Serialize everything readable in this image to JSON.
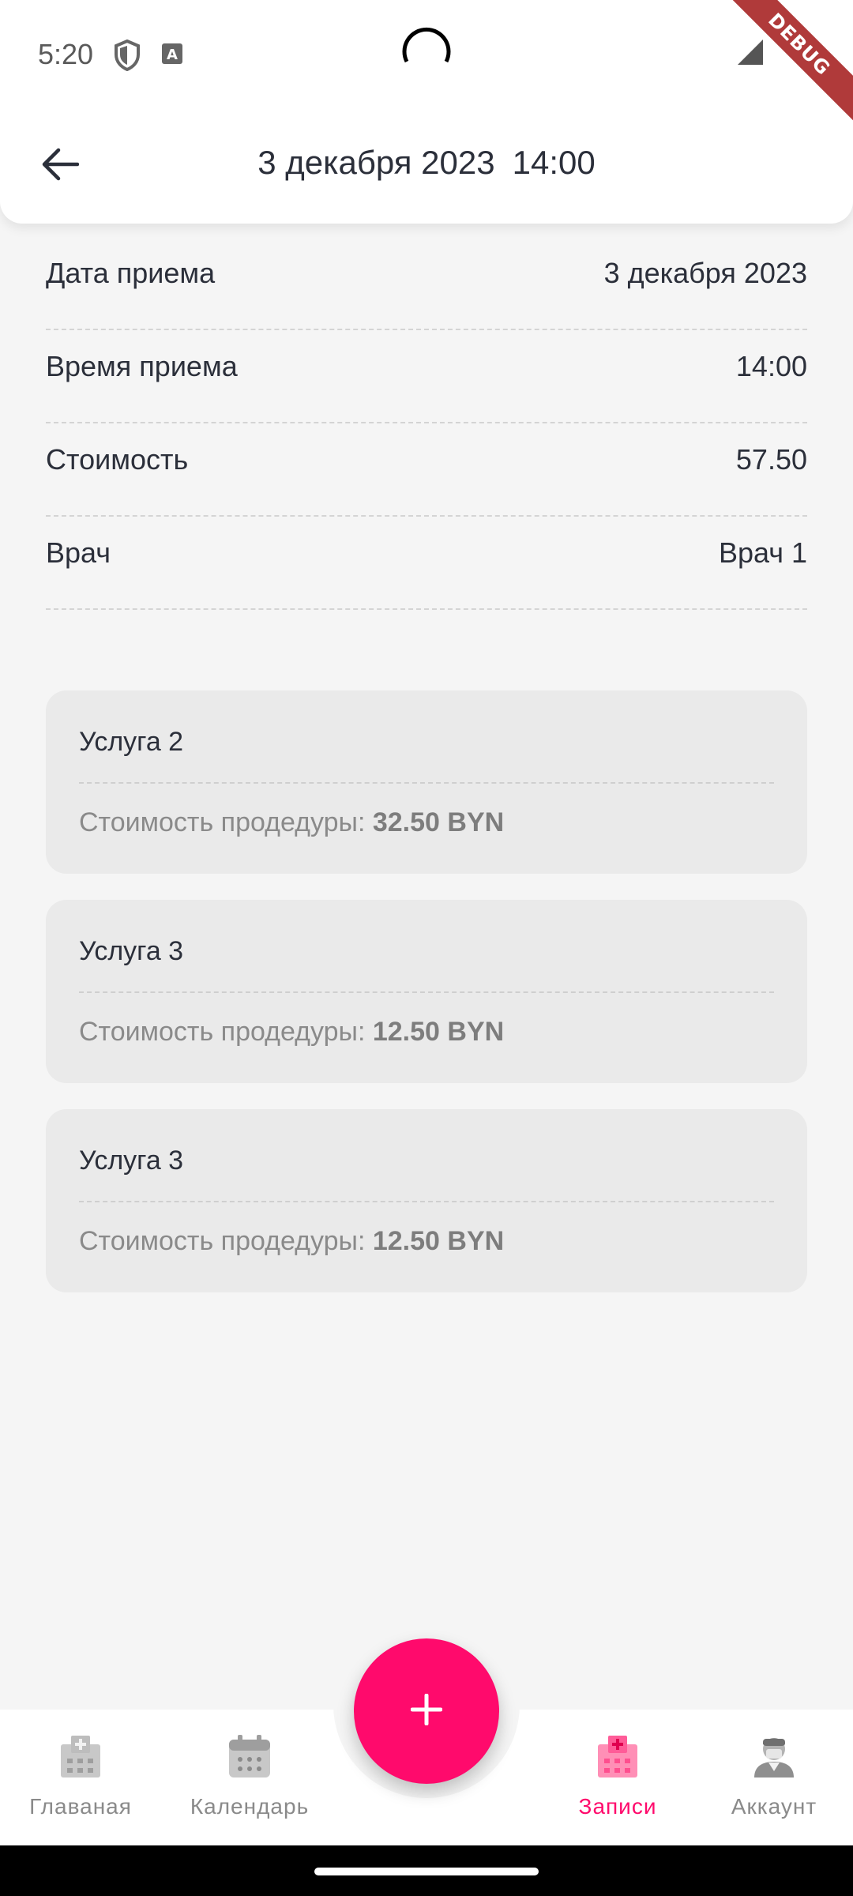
{
  "status_bar": {
    "time": "5:20",
    "debug_label": "DEBUG"
  },
  "app_bar": {
    "title_date": "3 декабря 2023",
    "title_time": "14:00",
    "back_icon": "arrow-left-icon"
  },
  "details": [
    {
      "label": "Дата приема",
      "value": "3 декабря 2023"
    },
    {
      "label": "Время приема",
      "value": "14:00"
    },
    {
      "label": "Стоимость",
      "value": "57.50"
    },
    {
      "label": "Врач",
      "value": "Врач 1"
    }
  ],
  "services": [
    {
      "name": "Услуга 2",
      "price_label": "Стоимость продедуры:",
      "price": "32.50 BYN"
    },
    {
      "name": "Услуга 3",
      "price_label": "Стоимость продедуры:",
      "price": "12.50 BYN"
    },
    {
      "name": "Услуга 3",
      "price_label": "Стоимость продедуры:",
      "price": "12.50 BYN"
    }
  ],
  "fab": {
    "icon": "plus-icon"
  },
  "bottom_nav": [
    {
      "label": "Главаная",
      "icon": "hospital-icon",
      "active": false
    },
    {
      "label": "Календарь",
      "icon": "calendar-icon",
      "active": false
    },
    {
      "label": "Записи",
      "icon": "clinic-records-icon",
      "active": true
    },
    {
      "label": "Аккаунт",
      "icon": "doctor-icon",
      "active": false
    }
  ],
  "colors": {
    "accent": "#ff0a6c",
    "background": "#f5f5f5",
    "card": "#eaeaea",
    "text": "#2b2f3a",
    "muted": "#8a8a8a",
    "debug_ribbon": "#b03a3a"
  }
}
